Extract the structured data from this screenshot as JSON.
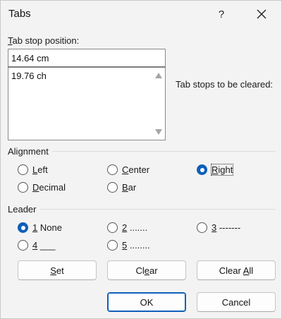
{
  "dialog": {
    "title": "Tabs",
    "help_label": "?",
    "close_icon": "close-icon"
  },
  "tab_stop": {
    "label_first": "T",
    "label_rest": "ab stop position:",
    "value": "14.64 cm",
    "list_items": [
      "19.76 ch"
    ],
    "cleared_label": "Tab stops to be cleared:"
  },
  "alignment": {
    "heading": "Alignment",
    "options": [
      {
        "key": "L",
        "rest": "eft",
        "checked": false
      },
      {
        "key": "C",
        "rest": "enter",
        "checked": false
      },
      {
        "key": "R",
        "rest": "ight",
        "checked": true
      },
      {
        "key": "D",
        "rest": "ecimal",
        "checked": false
      },
      {
        "key": "B",
        "rest": "ar",
        "checked": false
      }
    ]
  },
  "leader": {
    "heading": "Leader",
    "options": [
      {
        "key": "1",
        "rest": " None",
        "checked": true
      },
      {
        "key": "2",
        "rest": " .......",
        "checked": false
      },
      {
        "key": "3",
        "rest": " -------",
        "checked": false
      },
      {
        "key": "4",
        "rest": " ___",
        "checked": false
      },
      {
        "key": "5",
        "rest": " ........",
        "checked": false
      }
    ]
  },
  "buttons": {
    "set_key": "S",
    "set_rest": "et",
    "clear_pre": "Cl",
    "clear_key": "e",
    "clear_rest": "ar",
    "clear_all_pre": "Clear ",
    "clear_all_key": "A",
    "clear_all_rest": "ll",
    "ok": "OK",
    "cancel": "Cancel"
  },
  "colors": {
    "accent": "#0f5fb8",
    "background": "#f3f3f3"
  }
}
